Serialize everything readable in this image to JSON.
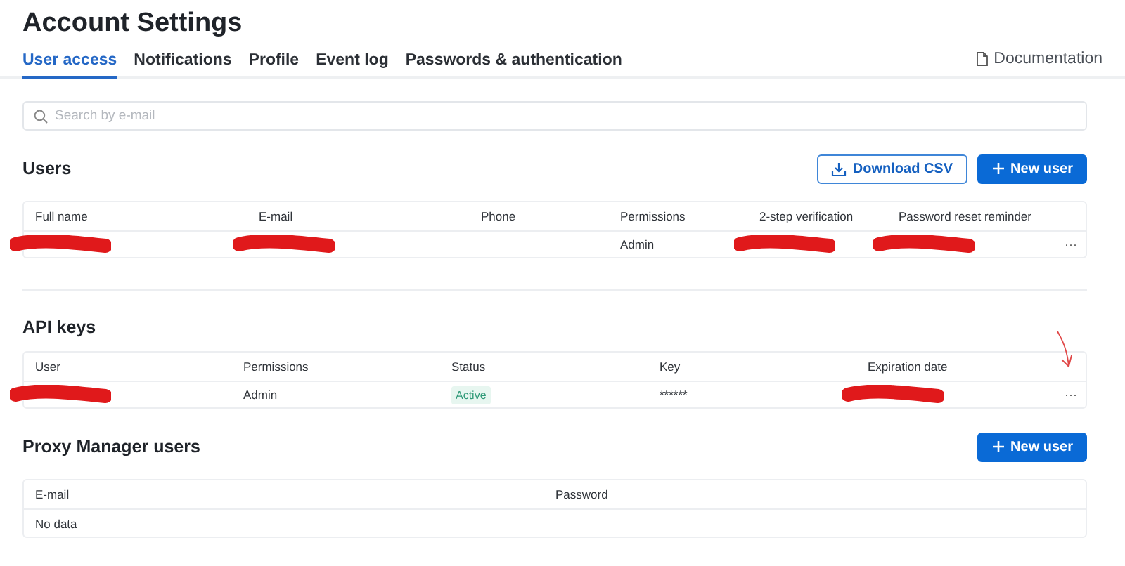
{
  "page": {
    "title": "Account Settings"
  },
  "tabs": [
    {
      "label": "User access",
      "selected": true
    },
    {
      "label": "Notifications",
      "selected": false
    },
    {
      "label": "Profile",
      "selected": false
    },
    {
      "label": "Event log",
      "selected": false
    },
    {
      "label": "Passwords & authentication",
      "selected": false
    }
  ],
  "documentation_link": "Documentation",
  "search": {
    "placeholder": "Search by e-mail"
  },
  "users": {
    "title": "Users",
    "buttons": [
      {
        "kind": "download",
        "label": "Download CSV"
      },
      {
        "kind": "add",
        "label": "New user"
      }
    ],
    "columns": [
      "Full name",
      "E-mail",
      "Phone",
      "Permissions",
      "2-step verification",
      "Password reset reminder"
    ],
    "rows": [
      {
        "cells": [
          {
            "kind": "redacted"
          },
          {
            "kind": "redacted"
          },
          {
            "kind": "empty"
          },
          {
            "kind": "text",
            "text": "Admin"
          },
          {
            "kind": "redacted"
          },
          {
            "kind": "redacted"
          }
        ],
        "more": "···"
      }
    ]
  },
  "api_keys": {
    "title": "API keys",
    "annotation_arrow": true,
    "columns": [
      "User",
      "Permissions",
      "Status",
      "Key",
      "Expiration date"
    ],
    "rows": [
      {
        "cells": [
          {
            "kind": "redacted"
          },
          {
            "kind": "text",
            "text": "Admin"
          },
          {
            "kind": "badge",
            "text": "Active"
          },
          {
            "kind": "text",
            "text": "******"
          },
          {
            "kind": "redacted"
          }
        ],
        "more": "···"
      }
    ]
  },
  "proxy_users": {
    "title": "Proxy Manager users",
    "buttons": [
      {
        "kind": "add",
        "label": "New user"
      }
    ],
    "columns": [
      "E-mail",
      "Password"
    ],
    "empty_text": "No data"
  }
}
